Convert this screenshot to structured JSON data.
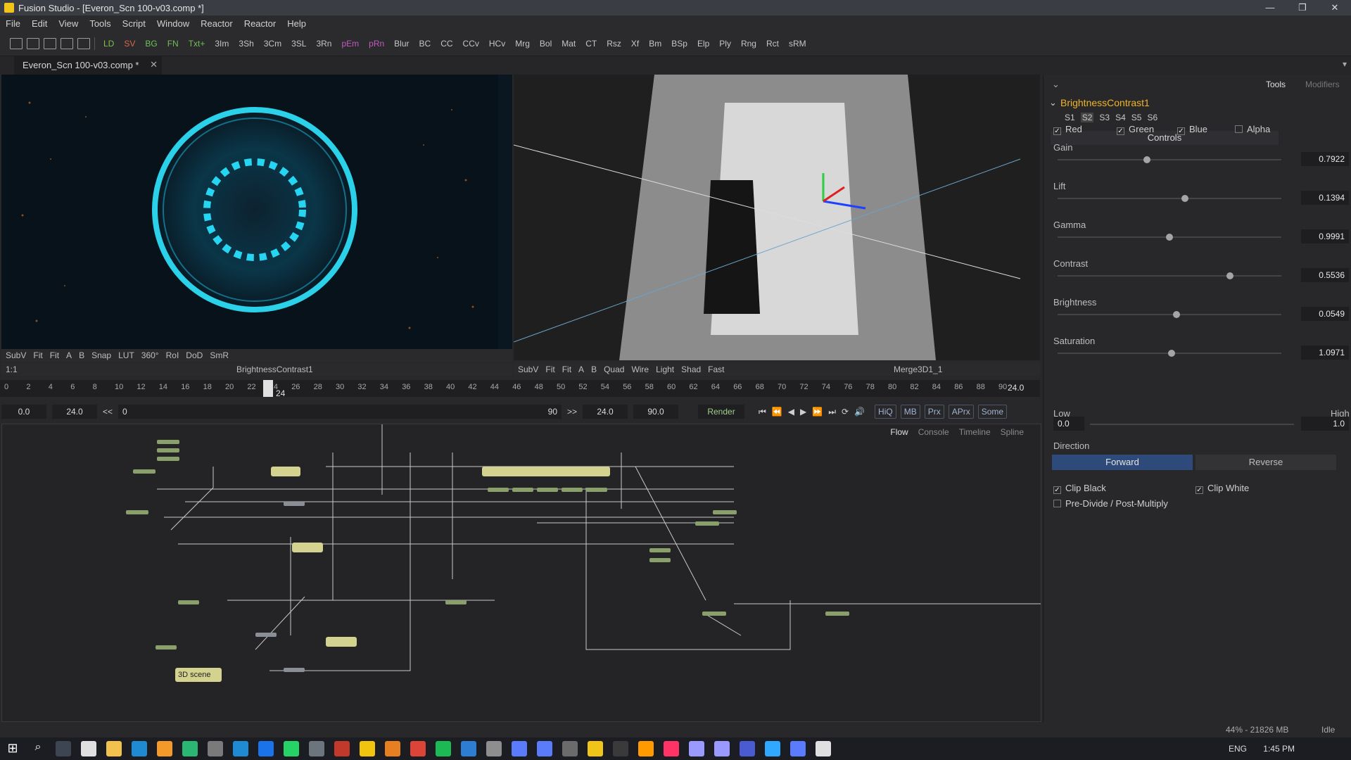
{
  "window": {
    "title": "Fusion Studio - [Everon_Scn 100-v03.comp *]",
    "controls": [
      "—",
      "❐",
      "✕"
    ]
  },
  "menu": [
    "File",
    "Edit",
    "View",
    "Tools",
    "Script",
    "Window",
    "Reactor",
    "Reactor",
    "Help"
  ],
  "toolbar": {
    "buttons": [
      "LD",
      "SV",
      "BG",
      "FN",
      "Txt+",
      "3Im",
      "3Sh",
      "3Cm",
      "3SL",
      "3Rn",
      "pEm",
      "pRn",
      "Blur",
      "BC",
      "CC",
      "CCv",
      "HCv",
      "Mrg",
      "Bol",
      "Mat",
      "CT",
      "Rsz",
      "Xf",
      "Bm",
      "BSp",
      "Elp",
      "Ply",
      "Rng",
      "Rct",
      "sRM"
    ],
    "colors": {
      "LD": "#7fbf4f",
      "SV": "#d9664a",
      "BG": "#6fc052",
      "FN": "#6fc052",
      "Txt+": "#6fc052",
      "pEm": "#c05ac0",
      "pRn": "#c05ac0"
    }
  },
  "document_tab": {
    "label": "Everon_Scn 100-v03.comp *",
    "close": "✕"
  },
  "viewer1": {
    "toolbar": [
      "SubV",
      "Fit",
      "Fit",
      "A",
      "B",
      "Snap",
      "LUT",
      "360°",
      "RoI",
      "DoD",
      "SmR"
    ],
    "ratio": "1:1",
    "node_name": "BrightnessContrast1"
  },
  "viewer2": {
    "toolbar": [
      "SubV",
      "Fit",
      "Fit",
      "A",
      "B",
      "Quad",
      "Wire",
      "Light",
      "Shad",
      "Fast"
    ],
    "node_name": "Merge3D1_1"
  },
  "timeline": {
    "ticks": [
      "0",
      "2",
      "4",
      "6",
      "8",
      "10",
      "12",
      "14",
      "16",
      "18",
      "20",
      "22",
      "24",
      "26",
      "28",
      "30",
      "32",
      "34",
      "36",
      "38",
      "40",
      "42",
      "44",
      "46",
      "48",
      "50",
      "52",
      "54",
      "56",
      "58",
      "60",
      "62",
      "64",
      "66",
      "68",
      "70",
      "72",
      "74",
      "76",
      "78",
      "80",
      "82",
      "84",
      "86",
      "88",
      "90"
    ],
    "current": "24",
    "end_display": "24.0",
    "start": "0.0",
    "render_start": "24.0",
    "scrub_start": "0",
    "scrub_end": "90",
    "current_field": "24.0",
    "end_field": "90.0",
    "render_label": "Render",
    "quality": [
      "HiQ",
      "MB",
      "Prx",
      "APrx",
      "Some"
    ]
  },
  "flow": {
    "tabs": [
      "Flow",
      "Console",
      "Timeline",
      "Spline"
    ],
    "notes": [
      "3D scene"
    ]
  },
  "inspector": {
    "tabs": [
      "Tools",
      "Modifiers"
    ],
    "tool_name": "BrightnessContrast1",
    "versions": [
      "S1",
      "S2",
      "S3",
      "S4",
      "S5",
      "S6"
    ],
    "controls_label": "Controls",
    "channels": [
      {
        "label": "Red",
        "checked": true
      },
      {
        "label": "Green",
        "checked": true
      },
      {
        "label": "Blue",
        "checked": true
      },
      {
        "label": "Alpha",
        "checked": false
      }
    ],
    "sliders": [
      {
        "label": "Gain",
        "value": "0.7922",
        "pos": 0.4
      },
      {
        "label": "Lift",
        "value": "0.1394",
        "pos": 0.57
      },
      {
        "label": "Gamma",
        "value": "0.9991",
        "pos": 0.5
      },
      {
        "label": "Contrast",
        "value": "0.5536",
        "pos": 0.77
      },
      {
        "label": "Brightness",
        "value": "0.0549",
        "pos": 0.53
      },
      {
        "label": "Saturation",
        "value": "1.0971",
        "pos": 0.51
      }
    ],
    "range": {
      "low_label": "Low",
      "high_label": "High",
      "low": "0.0",
      "high": "1.0"
    },
    "direction": {
      "label": "Direction",
      "forward": "Forward",
      "reverse": "Reverse"
    },
    "clip_black": "Clip Black",
    "clip_white": "Clip White",
    "predivide": "Pre-Divide / Post-Multiply"
  },
  "status": {
    "memory": "44% - 21826 MB",
    "state": "Idle"
  },
  "taskbar": {
    "lang": "ENG",
    "time": "1:45 PM"
  }
}
